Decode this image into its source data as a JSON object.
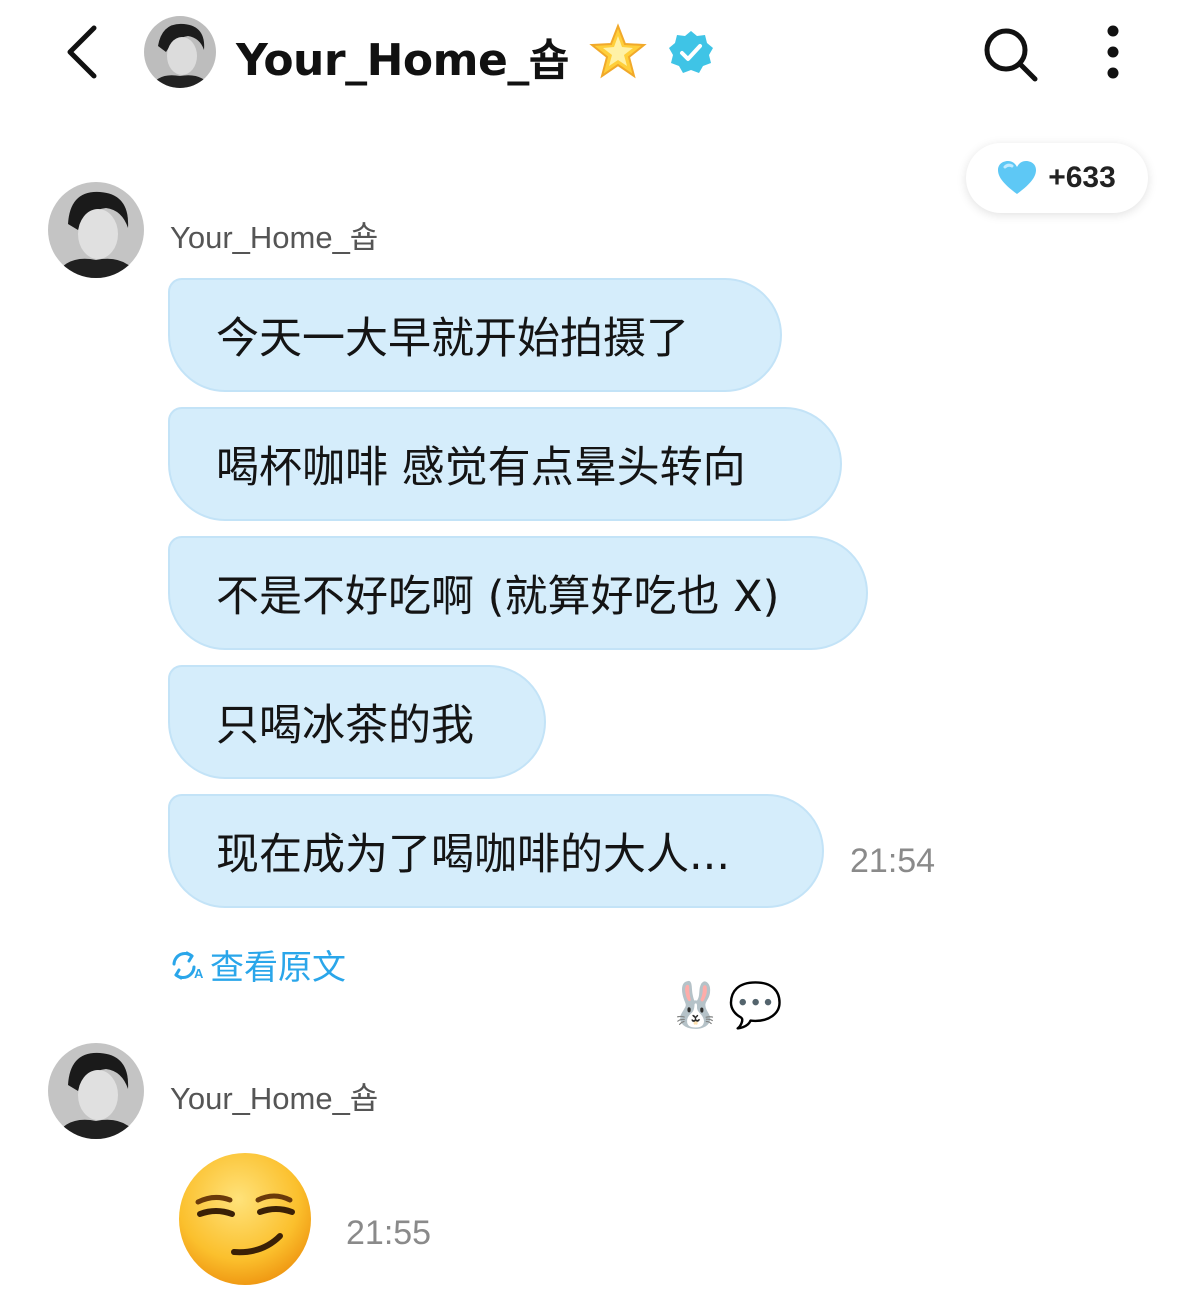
{
  "header": {
    "title": "Your_Home_숍",
    "icons": [
      "back-icon",
      "star-icon",
      "verified-badge-icon",
      "search-icon",
      "more-vertical-icon"
    ]
  },
  "like_badge": {
    "count": "+633",
    "icon": "heart-icon",
    "color": "#5ec8f5"
  },
  "messages": [
    {
      "sender": "Your_Home_숍",
      "bubbles": [
        "今天一大早就开始拍摄了",
        "喝杯咖啡 感觉有点晕头转向",
        "不是不好吃啊 (就算好吃也 X)",
        "只喝冰茶的我",
        "现在成为了喝咖啡的大人..."
      ],
      "time": "21:54",
      "translate_link": "查看原文",
      "reactions": [
        "🐰",
        "💬"
      ]
    },
    {
      "sender": "Your_Home_숍",
      "emoji": "😏",
      "time": "21:55"
    }
  ],
  "colors": {
    "bubble": "#d5edfb",
    "bubble_border": "#c3e3f7",
    "link": "#2aa6ea",
    "verified": "#3fc4e6"
  }
}
